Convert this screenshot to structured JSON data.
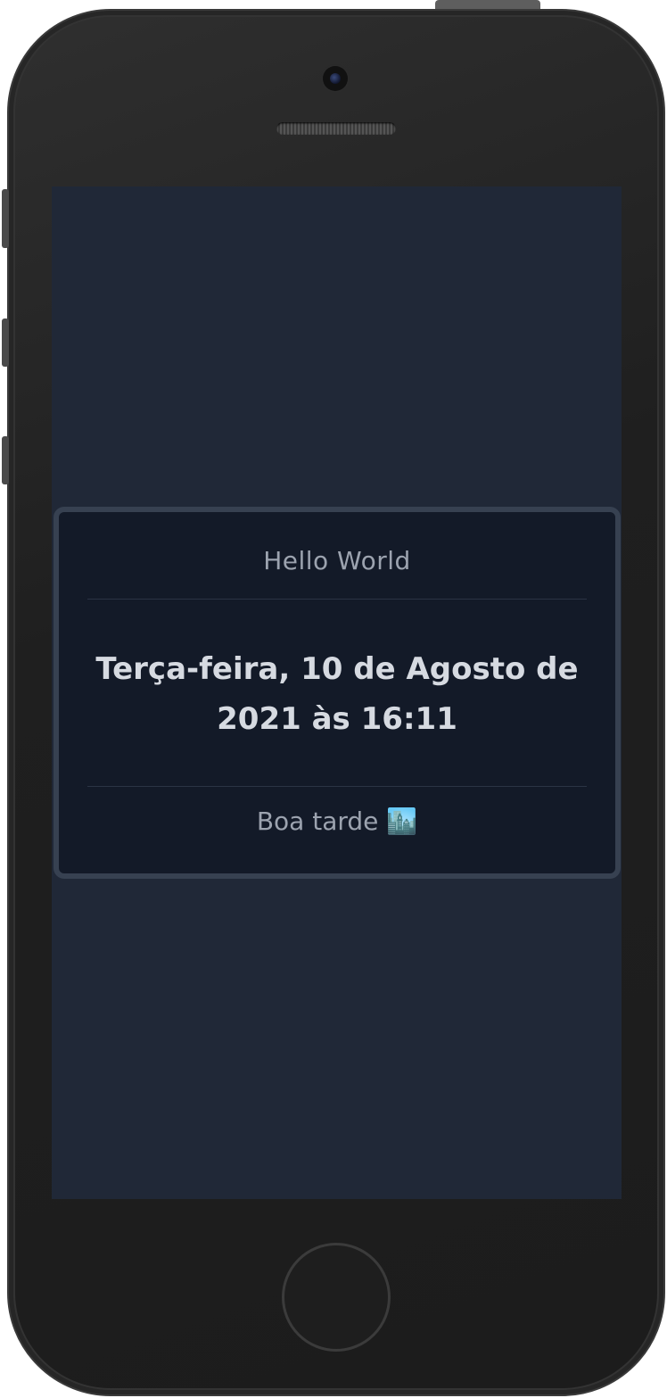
{
  "card": {
    "header": "Hello World",
    "title": "Terça-feira, 10 de Agosto de 2021 às 16:11",
    "footer": "Boa tarde 🏙️"
  },
  "colors": {
    "screen_background": "#202837",
    "card_background": "#131a28",
    "card_border": "#374151",
    "muted_text": "#9ca3af",
    "title_text": "#d6dae1"
  }
}
